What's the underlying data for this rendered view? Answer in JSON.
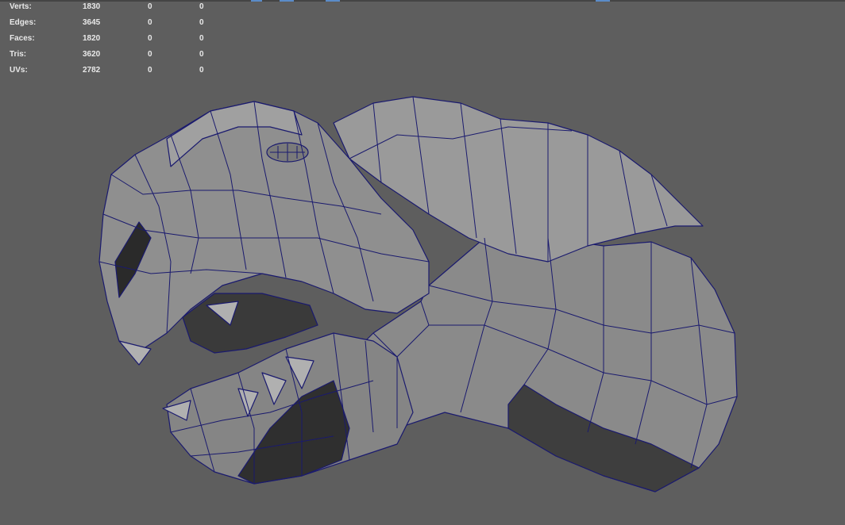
{
  "viewport": {
    "background": "#5e5e5e",
    "wire_color": "#1a1a6e",
    "mesh_fill": "#8e8e8e",
    "mesh_shade": "#5a5a5a",
    "mesh_dark": "#3c3c3c"
  },
  "hud": {
    "rows": [
      {
        "label": "Verts:",
        "value": "1830",
        "a": "0",
        "b": "0"
      },
      {
        "label": "Edges:",
        "value": "3645",
        "a": "0",
        "b": "0"
      },
      {
        "label": "Faces:",
        "value": "1820",
        "a": "0",
        "b": "0"
      },
      {
        "label": "Tris:",
        "value": "3620",
        "a": "0",
        "b": "0"
      },
      {
        "label": "UVs:",
        "value": "2782",
        "a": "0",
        "b": "0"
      }
    ]
  }
}
